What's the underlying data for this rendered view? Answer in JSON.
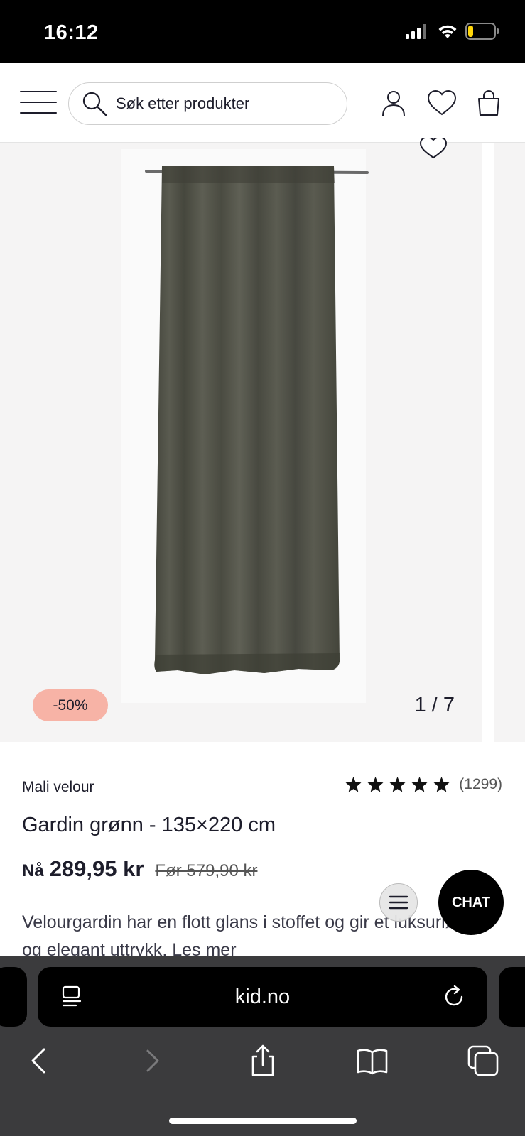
{
  "status_bar": {
    "time": "16:12",
    "battery_level": 0.2
  },
  "header": {
    "search_placeholder": "Søk etter produkter",
    "icons": [
      "menu-icon",
      "search-icon",
      "account-icon",
      "heart-icon",
      "bag-icon"
    ]
  },
  "gallery": {
    "discount_badge": "-50%",
    "image_counter": "1 / 7",
    "colors": {
      "background": "#f5f4f4",
      "curtain": "#4f5045",
      "badge": "#f7b3a6"
    }
  },
  "product": {
    "brand": "Mali velour",
    "rating": {
      "stars": 5,
      "count": "(1299)"
    },
    "title": "Gardin grønn - 135×220 cm",
    "price_now_label": "Nå",
    "price_now": "289,95 kr",
    "price_before": "Før 579,90 kr",
    "description": "Velourgardin har en flott glans i stoffet og gir et luksuriøst og elegant uttrykk. Les mer"
  },
  "chat": {
    "label": "CHAT"
  },
  "browser": {
    "url": "kid.no",
    "toolbar_icons": [
      "back-icon",
      "forward-icon",
      "share-icon",
      "bookmarks-icon",
      "tabs-icon"
    ]
  }
}
